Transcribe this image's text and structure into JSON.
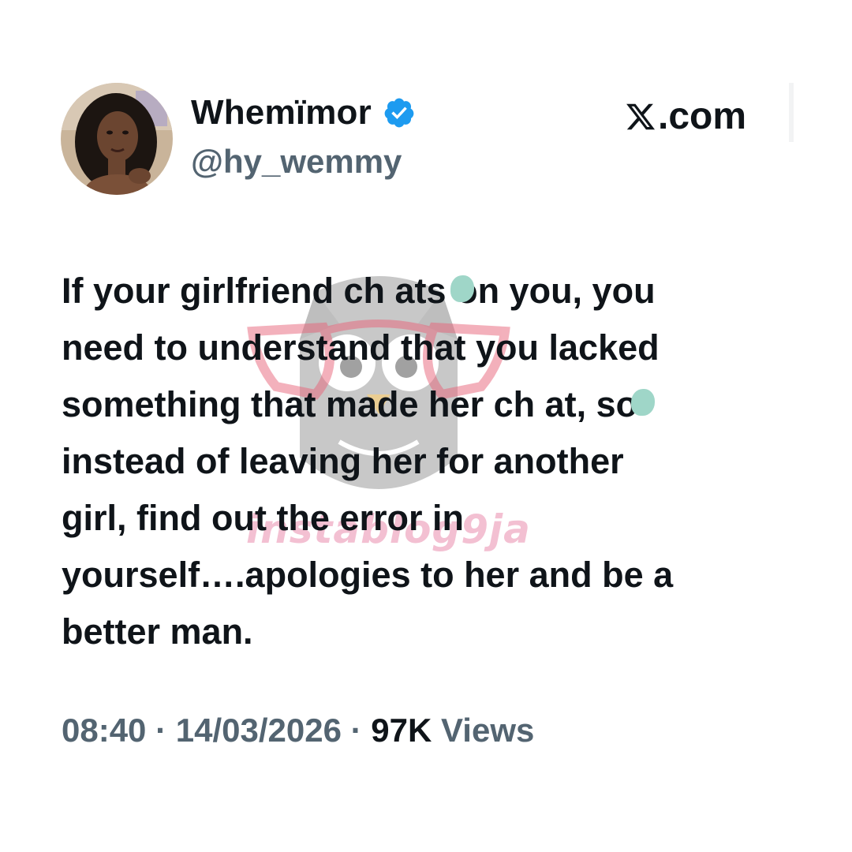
{
  "author": {
    "display_name": "Whemïmor",
    "handle": "@hy_wemmy",
    "verified": true
  },
  "brand": {
    "label": ".com",
    "logo_icon": "x-logo-icon"
  },
  "tweet": {
    "text": "If your girlfriend ch  ats on you, you\nneed to understand that you lacked\nsomething that made her ch  at, so\ninstead of leaving her for another\ngirl, find out the error in\nyourself….apologies to her and be a\nbetter man."
  },
  "meta": {
    "time": "08:40",
    "separator": " · ",
    "date": "14/03/2026",
    "views_count": "97K",
    "views_label": "Views"
  },
  "watermark": {
    "text": "instablog9ja"
  },
  "colors": {
    "text_primary": "#0f1419",
    "text_secondary": "#536471",
    "verified_blue": "#1d9bf0",
    "censor_blot": "#9fd6c8",
    "watermark_pink": "#e882a5"
  }
}
